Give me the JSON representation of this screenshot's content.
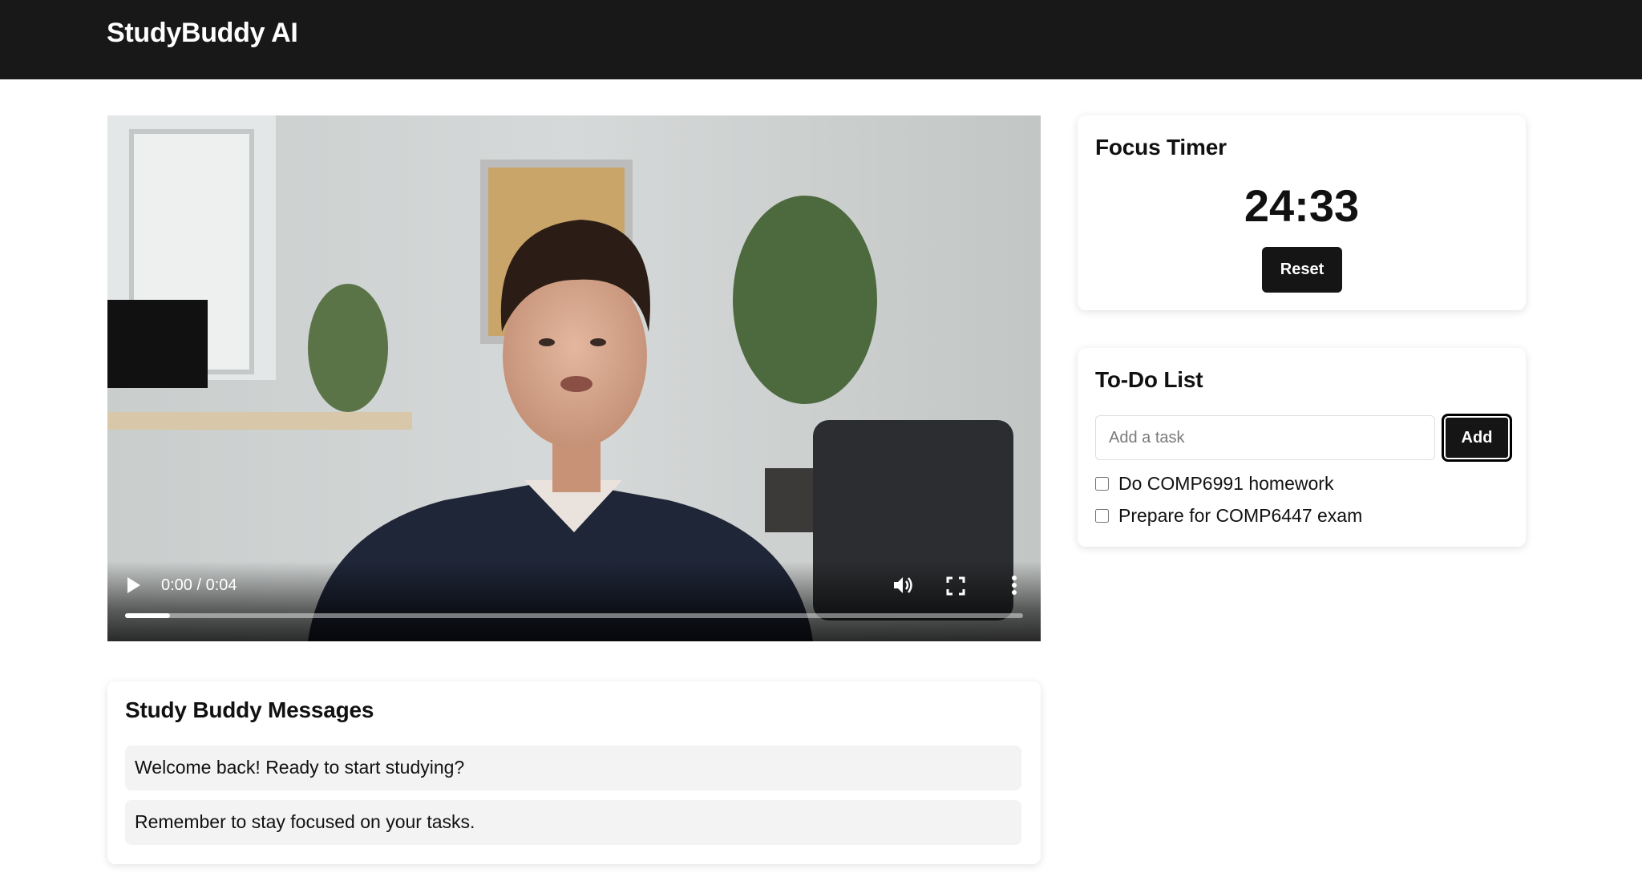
{
  "app": {
    "title": "StudyBuddy AI"
  },
  "video": {
    "time_label": "0:00 / 0:04",
    "progress": 0.05,
    "icons": [
      "play-icon",
      "volume-icon",
      "fullscreen-icon",
      "more-vertical-icon"
    ]
  },
  "messages": {
    "title": "Study Buddy Messages",
    "items": [
      "Welcome back! Ready to start studying?",
      "Remember to stay focused on your tasks."
    ]
  },
  "timer": {
    "title": "Focus Timer",
    "value": "24:33",
    "reset_label": "Reset"
  },
  "todo": {
    "title": "To-Do List",
    "input_placeholder": "Add a task",
    "input_value": "",
    "add_label": "Add",
    "tasks": [
      {
        "label": "Do COMP6991 homework",
        "checked": false
      },
      {
        "label": "Prepare for COMP6447 exam",
        "checked": false
      }
    ]
  },
  "colors": {
    "header_bg": "#181818",
    "button_bg": "#151515",
    "message_bg": "#f3f3f3"
  }
}
